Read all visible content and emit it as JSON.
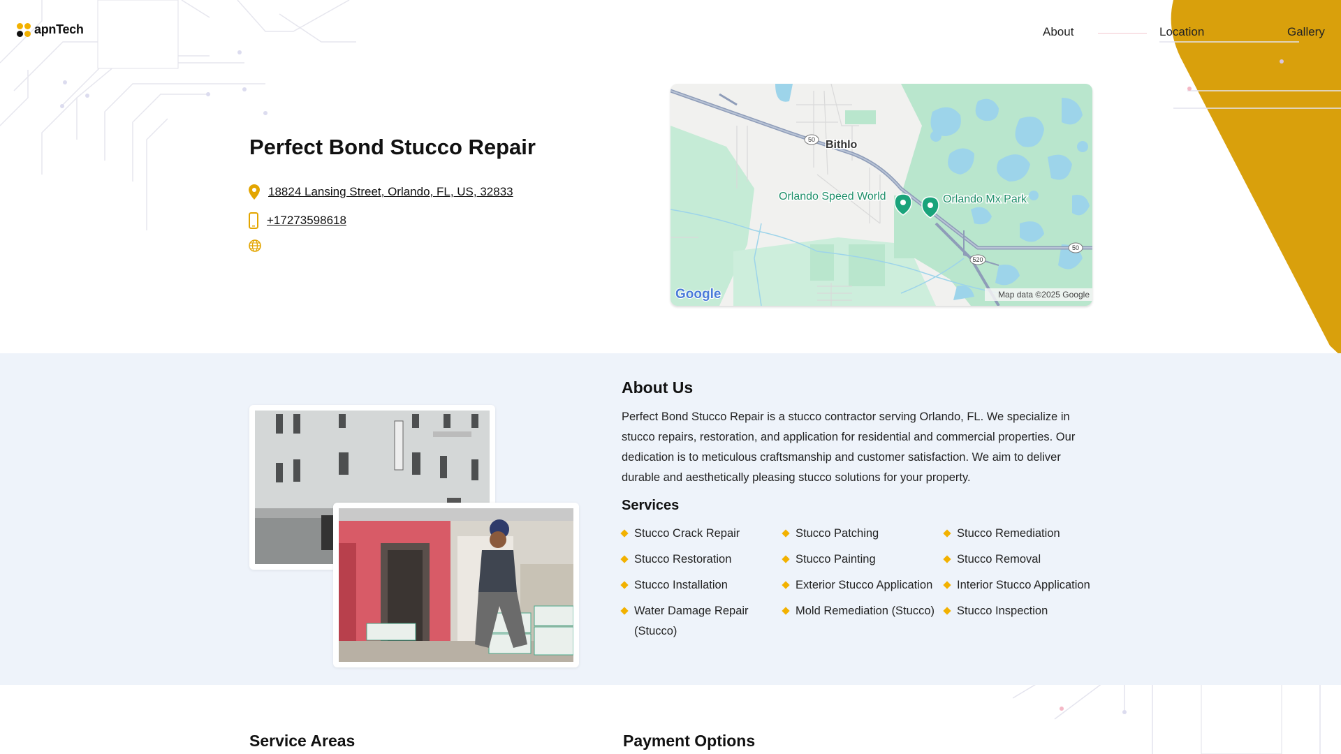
{
  "header": {
    "logo_text": "apnTech",
    "nav": [
      {
        "label": "About"
      },
      {
        "label": "Location"
      },
      {
        "label": "Gallery"
      }
    ]
  },
  "business": {
    "name": "Perfect Bond Stucco Repair",
    "address": "18824 Lansing Street, Orlando, FL, US, 32833",
    "phone": "+17273598618",
    "icons": [
      "map-pin-icon",
      "phone-icon",
      "globe-icon"
    ]
  },
  "map": {
    "places": [
      "Bithlo",
      "Orlando Speed World",
      "Orlando Mx Park"
    ],
    "route_shields": [
      "50",
      "520",
      "50"
    ],
    "logo": "Google",
    "attribution": "Map data ©2025 Google"
  },
  "about": {
    "title": "About Us",
    "text": "Perfect Bond Stucco Repair is a stucco contractor serving Orlando, FL. We specialize in stucco repairs, restoration, and application for residential and commercial properties. Our dedication is to meticulous craftsmanship and customer satisfaction. We aim to deliver durable and aesthetically pleasing stucco solutions for your property.",
    "services_title": "Services",
    "services": [
      "Stucco Crack Repair",
      "Stucco Patching",
      "Stucco Remediation",
      "Stucco Restoration",
      "Stucco Painting",
      "Stucco Removal",
      "Stucco Installation",
      "Exterior Stucco Application",
      "Interior Stucco Application",
      "Water Damage Repair (Stucco)",
      "Mold Remediation (Stucco)",
      "Stucco Inspection"
    ]
  },
  "sections": {
    "service_areas": "Service Areas",
    "payment_options": "Payment Options"
  },
  "colors": {
    "accent": "#f2b100",
    "section_bg": "#eef3fa",
    "map_water": "#9dd4ea",
    "map_park": "#b9e6cd"
  }
}
